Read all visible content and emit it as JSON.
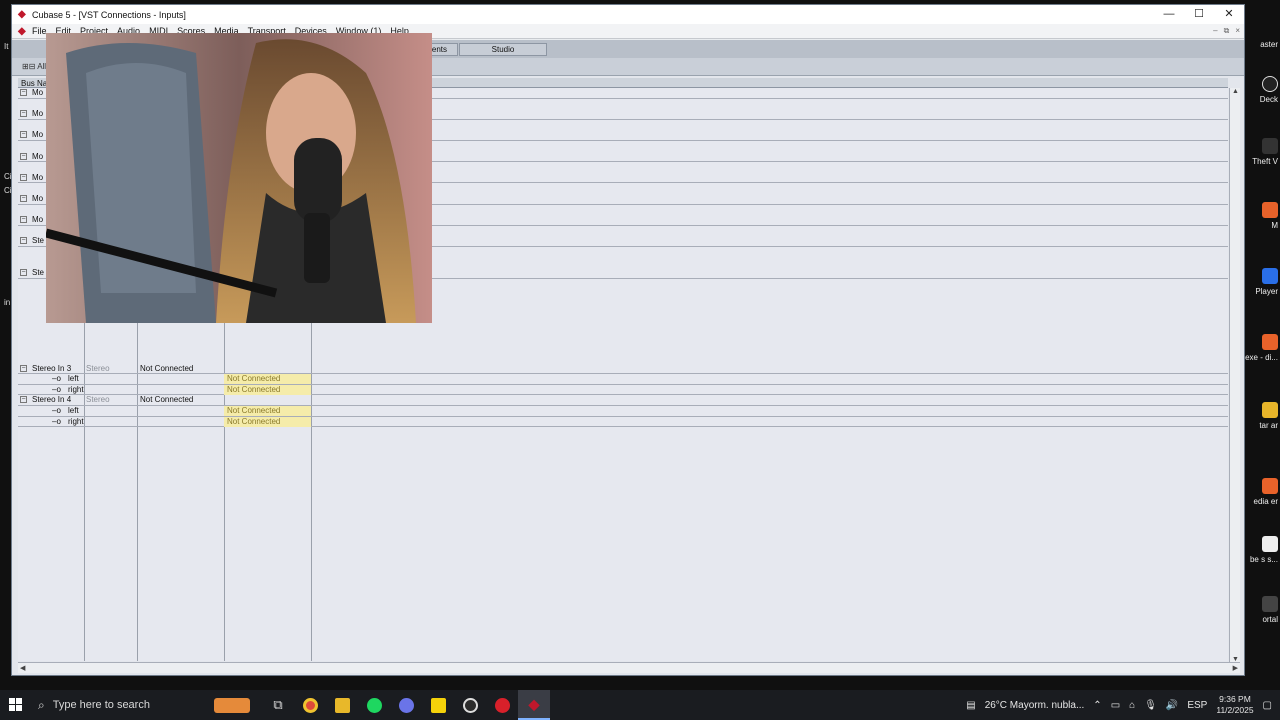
{
  "window": {
    "title": "Cubase 5 - [VST Connections - Inputs]",
    "controls": {
      "minimize": "—",
      "maximize": "☐",
      "close": "✕"
    }
  },
  "menu": [
    "File",
    "Edit",
    "Project",
    "Audio",
    "MIDI",
    "Scores",
    "Media",
    "Transport",
    "Devices",
    "Window (1)",
    "Help"
  ],
  "tabs": {
    "partial": "ments",
    "studio": "Studio"
  },
  "toolbar": {
    "expand_all": "All"
  },
  "columns": {
    "bus_name": "Bus Nar"
  },
  "bus_prefixes": [
    "Mo",
    "Mo",
    "Mo",
    "Mo",
    "Mo",
    "Mo",
    "Mo",
    "Ste",
    "Ste"
  ],
  "buses": [
    {
      "name": "Stereo In 3",
      "type": "Stereo",
      "device": "Not Connected",
      "channels": [
        {
          "name": "left",
          "port": "Not Connected"
        },
        {
          "name": "right",
          "port": "Not Connected"
        }
      ]
    },
    {
      "name": "Stereo In 4",
      "type": "Stereo",
      "device": "Not Connected",
      "channels": [
        {
          "name": "left",
          "port": "Not Connected"
        },
        {
          "name": "right",
          "port": "Not Connected"
        }
      ]
    }
  ],
  "desktop_labels": {
    "left": [
      "It",
      "Ci",
      "Ci",
      "in"
    ],
    "right": [
      "aster",
      "Deck",
      "Theft V",
      "M",
      "Player",
      "exe - di...",
      "tar\nar",
      "edia\ner",
      "be\ns s...",
      "ortal"
    ]
  },
  "taskbar": {
    "search_placeholder": "Type here to search",
    "weather": "26°C  Mayorm. nubla...",
    "lang": "ESP",
    "time": "9:36 PM",
    "date": "11/2/2025"
  },
  "colors": {
    "accent": "#c0182c",
    "not_connected_bg": "#f5ecaa"
  }
}
